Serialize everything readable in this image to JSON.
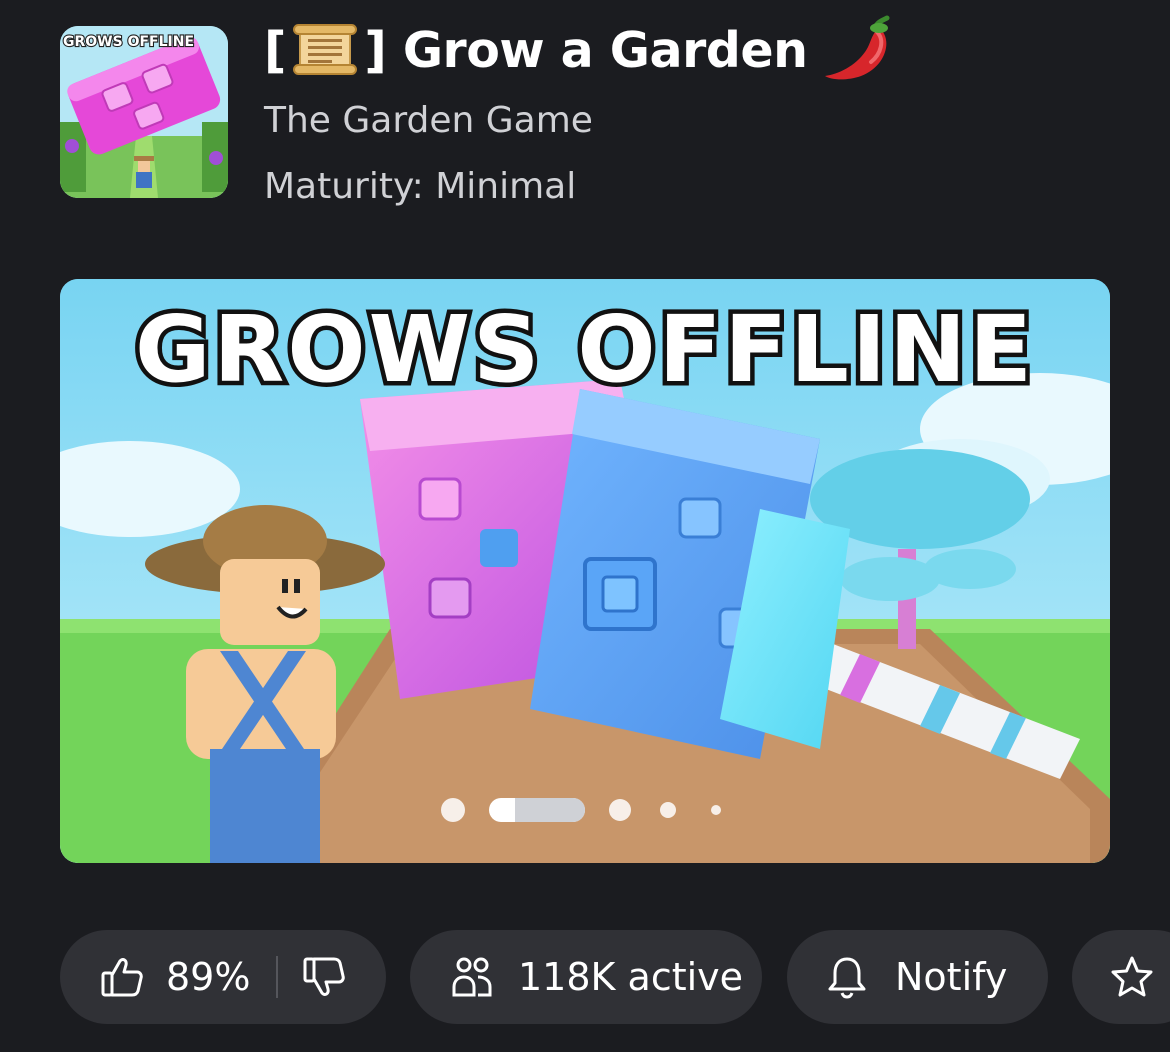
{
  "game": {
    "title_prefix": "[",
    "title_suffix": "]",
    "title_name": "Grow a Garden",
    "creator": "The Garden Game",
    "maturity": "Maturity: Minimal",
    "thumbnail_text": "GROWS OFFLINE",
    "icons": [
      "scroll-icon",
      "chili-pepper-icon"
    ]
  },
  "banner": {
    "headline": "GROWS OFFLINE",
    "carousel": {
      "total": 5,
      "active_index": 1
    }
  },
  "actions": {
    "rating": "89%",
    "active_players": "118K active",
    "notify_label": "Notify",
    "icons": [
      "thumbs-up-icon",
      "thumbs-down-icon",
      "players-icon",
      "bell-icon",
      "star-icon"
    ]
  },
  "colors": {
    "background": "#1b1c20",
    "pill_background": "#303136",
    "text_primary": "#ffffff",
    "text_secondary": "#d0d1d5"
  }
}
